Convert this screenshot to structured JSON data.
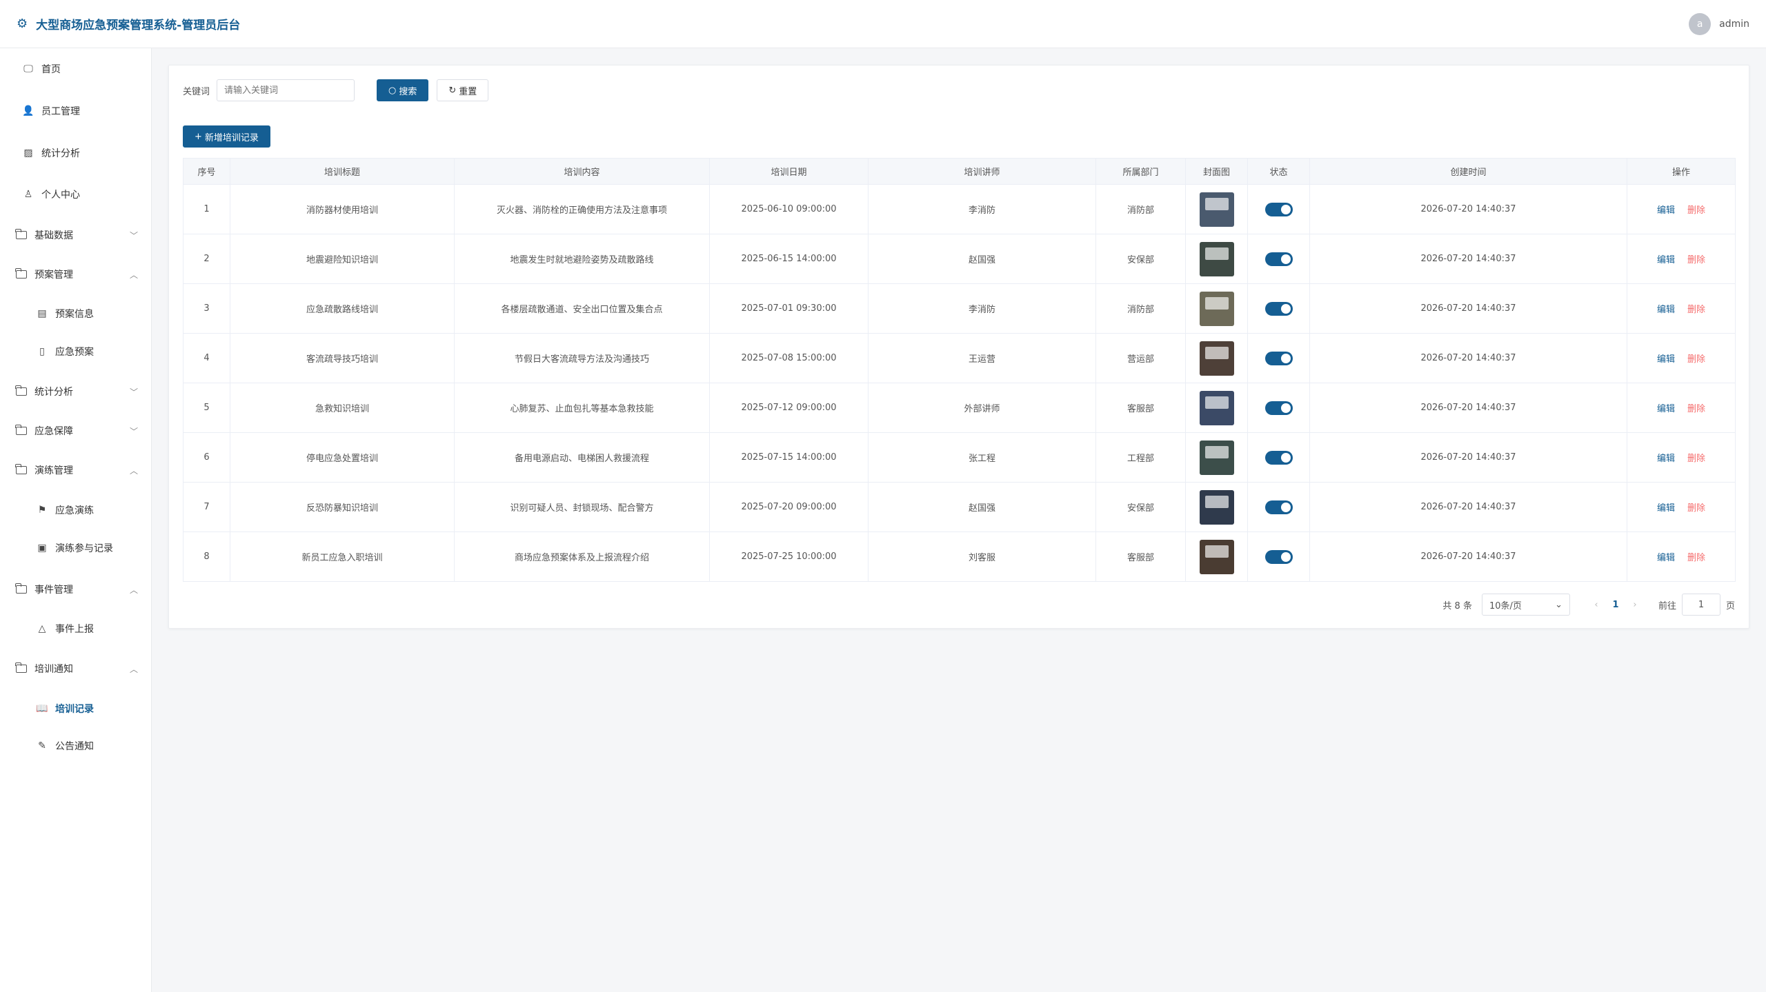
{
  "header": {
    "title": "大型商场应急预案管理系统-管理员后台",
    "avatar_letter": "a",
    "username": "admin"
  },
  "sidebar": [
    {
      "label": "首页",
      "icon": "monitor-icon",
      "level": 1
    },
    {
      "label": "员工管理",
      "icon": "user-icon",
      "level": 1
    },
    {
      "label": "统计分析",
      "icon": "chart-icon",
      "level": 1
    },
    {
      "label": "个人中心",
      "icon": "user-outline-icon",
      "level": 1
    },
    {
      "label": "基础数据",
      "icon": "folder-icon",
      "level": 0,
      "chevron": "down"
    },
    {
      "label": "预案管理",
      "icon": "folder-icon",
      "level": 0,
      "chevron": "up"
    },
    {
      "label": "预案信息",
      "icon": "document-icon",
      "level": 2
    },
    {
      "label": "应急预案",
      "icon": "book-icon",
      "level": 2
    },
    {
      "label": "统计分析",
      "icon": "folder-icon",
      "level": 0,
      "chevron": "down"
    },
    {
      "label": "应急保障",
      "icon": "folder-icon",
      "level": 0,
      "chevron": "down"
    },
    {
      "label": "演练管理",
      "icon": "folder-icon",
      "level": 0,
      "chevron": "up"
    },
    {
      "label": "应急演练",
      "icon": "flag-icon",
      "level": 2
    },
    {
      "label": "演练参与记录",
      "icon": "clipboard-icon",
      "level": 2
    },
    {
      "label": "事件管理",
      "icon": "folder-icon",
      "level": 0,
      "chevron": "up"
    },
    {
      "label": "事件上报",
      "icon": "bell-icon",
      "level": 2
    },
    {
      "label": "培训通知",
      "icon": "folder-icon",
      "level": 0,
      "chevron": "up"
    },
    {
      "label": "培训记录",
      "icon": "open-book-icon",
      "level": 2,
      "active": true
    },
    {
      "label": "公告通知",
      "icon": "edit-note-icon",
      "level": 2
    }
  ],
  "search": {
    "label": "关键词",
    "placeholder": "请输入关键词",
    "search_button": "搜索",
    "reset_button": "重置"
  },
  "add_button": "新增培训记录",
  "table": {
    "columns": [
      "序号",
      "培训标题",
      "培训内容",
      "培训日期",
      "培训讲师",
      "所属部门",
      "封面图",
      "状态",
      "创建时间",
      "操作"
    ],
    "rows": [
      {
        "no": "1",
        "title": "消防器材使用培训",
        "content": "灭火器、消防栓的正确使用方法及注意事项",
        "date": "2025-06-10 09:00:00",
        "trainer": "李消防",
        "dept": "消防部",
        "created": "2026-07-20 14:40:37",
        "thumb_color": "#4a5a6e"
      },
      {
        "no": "2",
        "title": "地震避险知识培训",
        "content": "地震发生时就地避险姿势及疏散路线",
        "date": "2025-06-15 14:00:00",
        "trainer": "赵国强",
        "dept": "安保部",
        "created": "2026-07-20 14:40:37",
        "thumb_color": "#3e4a44"
      },
      {
        "no": "3",
        "title": "应急疏散路线培训",
        "content": "各楼层疏散通道、安全出口位置及集合点",
        "date": "2025-07-01 09:30:00",
        "trainer": "李消防",
        "dept": "消防部",
        "created": "2026-07-20 14:40:37",
        "thumb_color": "#6d6a58"
      },
      {
        "no": "4",
        "title": "客流疏导技巧培训",
        "content": "节假日大客流疏导方法及沟通技巧",
        "date": "2025-07-08 15:00:00",
        "trainer": "王运营",
        "dept": "营运部",
        "created": "2026-07-20 14:40:37",
        "thumb_color": "#4e4038"
      },
      {
        "no": "5",
        "title": "急救知识培训",
        "content": "心肺复苏、止血包扎等基本急救技能",
        "date": "2025-07-12 09:00:00",
        "trainer": "外部讲师",
        "dept": "客服部",
        "created": "2026-07-20 14:40:37",
        "thumb_color": "#3b4a66"
      },
      {
        "no": "6",
        "title": "停电应急处置培训",
        "content": "备用电源启动、电梯困人救援流程",
        "date": "2025-07-15 14:00:00",
        "trainer": "张工程",
        "dept": "工程部",
        "created": "2026-07-20 14:40:37",
        "thumb_color": "#3c4e4a"
      },
      {
        "no": "7",
        "title": "反恐防暴知识培训",
        "content": "识别可疑人员、封锁现场、配合警方",
        "date": "2025-07-20 09:00:00",
        "trainer": "赵国强",
        "dept": "安保部",
        "created": "2026-07-20 14:40:37",
        "thumb_color": "#2f3a4c"
      },
      {
        "no": "8",
        "title": "新员工应急入职培训",
        "content": "商场应急预案体系及上报流程介绍",
        "date": "2025-07-25 10:00:00",
        "trainer": "刘客服",
        "dept": "客服部",
        "created": "2026-07-20 14:40:37",
        "thumb_color": "#4a3c32"
      }
    ],
    "edit_label": "编辑",
    "delete_label": "删除"
  },
  "pagination": {
    "total": "共 8 条",
    "page_size": "10条/页",
    "current_page": "1",
    "goto_label": "前往",
    "goto_value": "1",
    "page_suffix": "页"
  },
  "colors": {
    "primary": "#155e93",
    "danger": "#f56c6c"
  }
}
